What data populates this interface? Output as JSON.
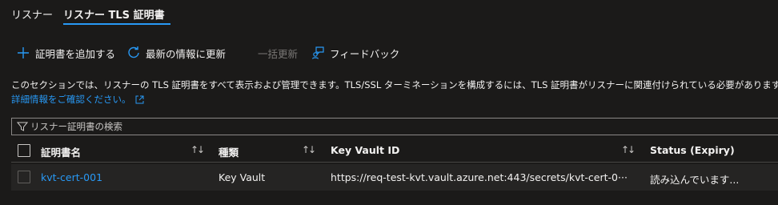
{
  "tabs": [
    {
      "label": "リスナー"
    },
    {
      "label": "リスナー TLS 証明書"
    }
  ],
  "toolbar": {
    "add_label": "証明書を追加する",
    "refresh_label": "最新の情報に更新",
    "bulk_update_label": "一括更新",
    "feedback_label": "フィードバック"
  },
  "description": {
    "text": "このセクションでは、リスナーの TLS 証明書をすべて表示および管理できます。TLS/SSL ターミネーションを構成するには、TLS 証明書がリスナーに関連付けられている必要があります。新しい",
    "link_text": "詳細情報をご確認ください。"
  },
  "search": {
    "placeholder": "リスナー証明書の検索"
  },
  "table": {
    "columns": [
      {
        "label": "証明書名"
      },
      {
        "label": "種類"
      },
      {
        "label": "Key Vault ID"
      },
      {
        "label": "Status (Expiry)"
      }
    ],
    "sort_glyph": "↑↓",
    "rows": [
      {
        "name": "kvt-cert-001",
        "type": "Key Vault",
        "key_vault_id": "https://req-test-kvt.vault.azure.net:443/secrets/kvt-cert-0···",
        "status": "読み込んでいます..."
      }
    ]
  },
  "colors": {
    "background": "#1b1a19",
    "accent": "#2899f5",
    "text": "#f3f2f1",
    "row_background": "#252423",
    "disabled_text": "#797775"
  }
}
